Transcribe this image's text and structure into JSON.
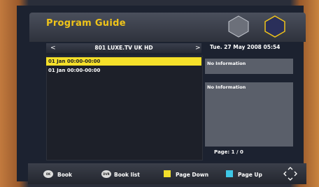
{
  "header": {
    "title": "Program Guide"
  },
  "channel": {
    "name": "801 LUXE.TV UK HD",
    "prev": "<",
    "next": ">"
  },
  "datetime": "Tue.  27 May 2008 05:54",
  "events": [
    {
      "time": "01 Jan 00:00-00:00",
      "selected": true
    },
    {
      "time": "01 Jan 00:00-00:00",
      "selected": false
    }
  ],
  "info": {
    "primary": "No Information",
    "secondary": "No Information"
  },
  "page": "Page:  1 / 0",
  "footer": {
    "ok_badge": "OK",
    "book": "Book",
    "dvr_badge": "DVR",
    "book_list": "Book list",
    "page_down": "Page Down",
    "page_up": "Page Up"
  },
  "colors": {
    "accent": "#f0c419",
    "selection": "#f5e02a",
    "page_down": "#f2de2b",
    "page_up": "#3ec7e6"
  }
}
